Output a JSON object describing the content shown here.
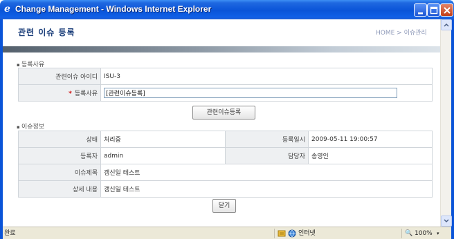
{
  "window": {
    "title": "Change Management - Windows Internet Explorer",
    "logo_glyph": "e"
  },
  "page": {
    "title": "관련 이슈 등록",
    "breadcrumb": "HOME > 이슈관리"
  },
  "section1": {
    "label": "등록사유",
    "rows": {
      "issue_id_label": "관련이슈 아이디",
      "issue_id_value": "ISU-3",
      "reason_label": "등록사유",
      "reason_value": "[관련이슈등록]"
    },
    "required_mark": "*",
    "register_button": "관련이슈등록"
  },
  "section2": {
    "label": "이슈정보",
    "status_label": "상태",
    "status_value": "처리중",
    "reg_date_label": "등록일시",
    "reg_date_value": "2009-05-11 19:00:57",
    "registrant_label": "등록자",
    "registrant_value": "admin",
    "assignee_label": "담당자",
    "assignee_value": "송영인",
    "subject_label": "이슈제목",
    "subject_value": "갱신일 테스트",
    "detail_label": "상세 내용",
    "detail_value": "갱신일 테스트"
  },
  "close_button": "닫기",
  "statusbar": {
    "status": "완료",
    "zone": "인터넷",
    "zoom": "100%"
  },
  "colors": {
    "titlebar": "#0a54d8",
    "label_bg": "#eef0f2",
    "required": "#d01010"
  }
}
